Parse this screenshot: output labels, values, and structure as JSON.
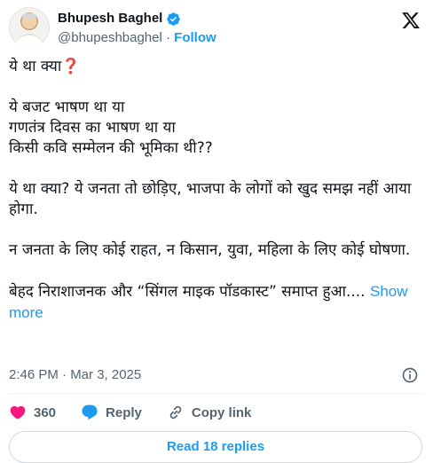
{
  "author": {
    "display_name": "Bhupesh Baghel",
    "handle": "@bhupeshbaghel",
    "separator": "·",
    "follow_label": "Follow"
  },
  "post": {
    "line1_text": "ये था क्या",
    "line1_emoji": "❓",
    "paragraph2": "ये बजट भाषण था या\nगणतंत्र दिवस का भाषण था या\nकिसी कवि सम्मेलन की भूमिका थी??",
    "paragraph3": "ये था क्या? ये जनता तो छोड़िए, भाजपा के लोगों को खुद समझ नहीं आया होगा.",
    "paragraph4": "न जनता के लिए कोई राहत, न किसान, युवा, महिला के लिए कोई घोषणा.",
    "paragraph5": "बेहद निराशाजनक और “सिंगल माइक पॉडकास्ट” समाप्त हुआ....",
    "show_more_label": "Show more",
    "timestamp": "2:46 PM · Mar 3, 2025"
  },
  "actions": {
    "like_count": "360",
    "reply_label": "Reply",
    "copy_link_label": "Copy link"
  },
  "replies_button_label": "Read 18 replies",
  "colors": {
    "accent": "#1d9bf0",
    "like": "#f91880",
    "text": "#0f1419",
    "muted": "#536471"
  }
}
